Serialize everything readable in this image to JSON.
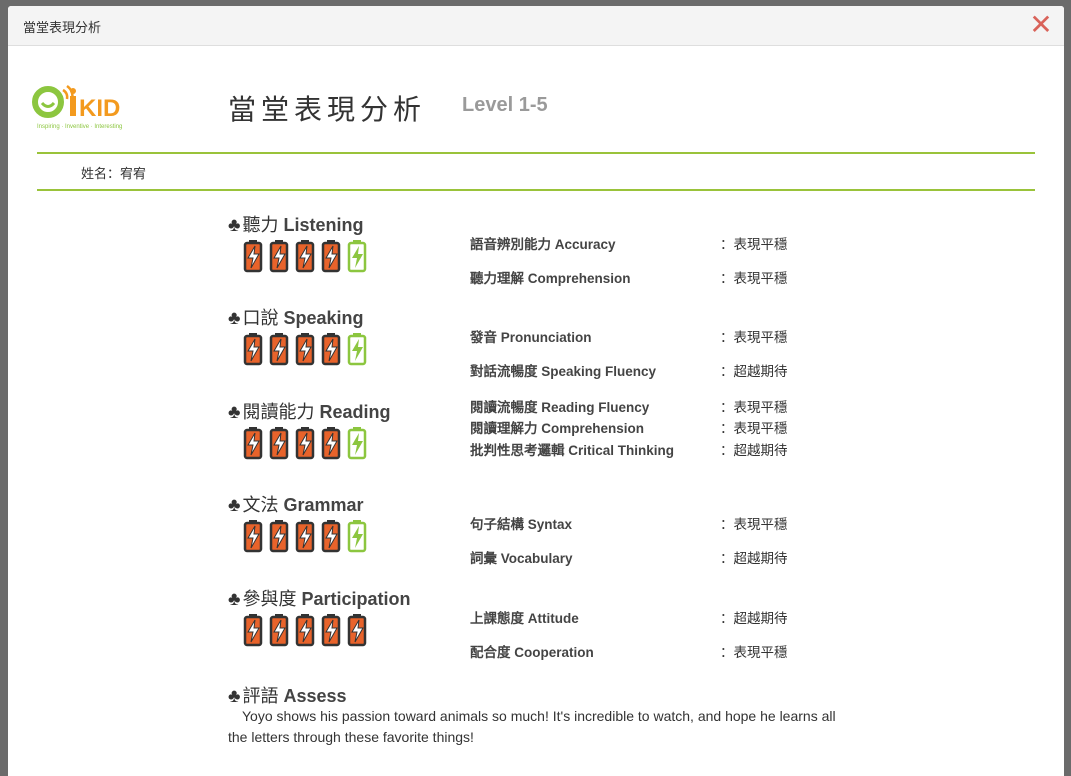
{
  "window": {
    "title": "當堂表現分析"
  },
  "logo": {
    "brand": "OiKID",
    "tagline": "Inspiring · Inventive · Interesting"
  },
  "report": {
    "title": "當堂表現分析",
    "level": "Level 1-5"
  },
  "student": {
    "label": "姓名：宥宥"
  },
  "colors": {
    "accent_green": "#9ac33a",
    "battery_orange": "#e8632b",
    "battery_green": "#8cc63f",
    "close_red": "#d9635a"
  },
  "sections": [
    {
      "title_zh": "聽力",
      "title_en": "Listening",
      "rating": 4,
      "max": 5,
      "items": [
        {
          "label": "語音辨別能力 Accuracy",
          "value": "：表現平穩"
        },
        {
          "label": "聽力理解 Comprehension",
          "value": "：表現平穩"
        }
      ]
    },
    {
      "title_zh": "口說",
      "title_en": "Speaking",
      "rating": 4,
      "max": 5,
      "items": [
        {
          "label": "發音 Pronunciation",
          "value": "：表現平穩"
        },
        {
          "label": "對話流暢度 Speaking Fluency",
          "value": "：超越期待"
        }
      ]
    },
    {
      "title_zh": "閱讀能力",
      "title_en": "Reading",
      "rating": 4,
      "max": 5,
      "items": [
        {
          "label": "閱讀流暢度 Reading Fluency",
          "value": "：表現平穩"
        },
        {
          "label": "閱讀理解力 Comprehension",
          "value": "：表現平穩"
        },
        {
          "label": "批判性思考邏輯 Critical Thinking",
          "value": "：超越期待"
        }
      ]
    },
    {
      "title_zh": "文法",
      "title_en": "Grammar",
      "rating": 4,
      "max": 5,
      "items": [
        {
          "label": "句子結構 Syntax",
          "value": "：表現平穩"
        },
        {
          "label": "詞彙 Vocabulary",
          "value": "：超越期待"
        }
      ]
    },
    {
      "title_zh": "參與度",
      "title_en": "Participation",
      "rating": 5,
      "max": 5,
      "items": [
        {
          "label": "上課態度 Attitude",
          "value": "：超越期待"
        },
        {
          "label": "配合度 Cooperation",
          "value": "：表現平穩"
        }
      ]
    }
  ],
  "assess": {
    "title_zh": "評語",
    "title_en": "Assess",
    "text": "Yoyo shows his passion toward animals so much! It's incredible to watch, and hope he learns all the letters through these favorite things!"
  }
}
